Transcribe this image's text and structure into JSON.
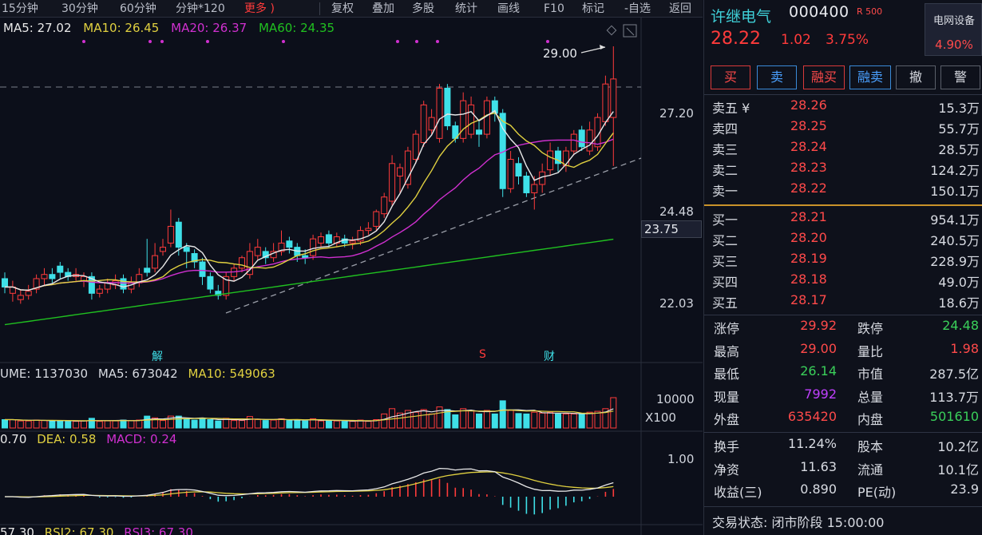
{
  "toolbar": {
    "items": [
      "15分钟",
      "30分钟",
      "60分钟",
      "分钟*120",
      "更多 )",
      "复权",
      "叠加",
      "多股",
      "统计",
      "画线",
      "F10",
      "标记",
      "-自选",
      "返回"
    ]
  },
  "ma_legend": {
    "ma5": "MA5: 27.02",
    "ma10": "MA10: 26.45",
    "ma20": "MA20: 26.37",
    "ma60": "MA60: 24.35"
  },
  "price_axis": {
    "labels": [
      "27.20",
      "24.48",
      "22.03"
    ],
    "current_box": "23.75",
    "high_marker": "29.00"
  },
  "event_markers": {
    "jie": "解",
    "s": "S",
    "cai": "财"
  },
  "volume_legend": {
    "vol": "UME: 1137030",
    "ma5": "MA5: 673042",
    "ma10": "MA10: 549063"
  },
  "volume_axis": {
    "label": "10000",
    "unit": "X100"
  },
  "macd_legend": {
    "dif": "0.70",
    "dea": "DEA: 0.58",
    "macd": "MACD: 0.24"
  },
  "macd_axis": {
    "label": "1.00"
  },
  "rsi_legend": {
    "rsi1": "57.30",
    "rsi2": "RSI2: 67.30",
    "rsi3": "RSI3: 67.30"
  },
  "stock": {
    "name": "许继电气",
    "code": "000400",
    "tag": "R 500",
    "price": "28.22",
    "change": "1.02",
    "change_pct": "3.75%",
    "sector_name": "电网设备",
    "sector_pct": "4.90%"
  },
  "trade_buttons": [
    "买",
    "卖",
    "融买",
    "融卖",
    "撤",
    "警"
  ],
  "order_book": {
    "asks": [
      {
        "label": "卖五 ¥",
        "price": "28.26",
        "volume": "15.3万"
      },
      {
        "label": "卖四",
        "price": "28.25",
        "volume": "55.7万"
      },
      {
        "label": "卖三",
        "price": "28.24",
        "volume": "28.5万"
      },
      {
        "label": "卖二",
        "price": "28.23",
        "volume": "124.2万"
      },
      {
        "label": "卖一",
        "price": "28.22",
        "volume": "150.1万"
      }
    ],
    "bids": [
      {
        "label": "买一",
        "price": "28.21",
        "volume": "954.1万"
      },
      {
        "label": "买二",
        "price": "28.20",
        "volume": "240.5万"
      },
      {
        "label": "买三",
        "price": "28.19",
        "volume": "228.9万"
      },
      {
        "label": "买四",
        "price": "28.18",
        "volume": "49.0万"
      },
      {
        "label": "买五",
        "price": "28.17",
        "volume": "18.6万"
      }
    ]
  },
  "stats": {
    "rows": [
      {
        "l1": "涨停",
        "v1": "29.92",
        "c1": "#ff4a4a",
        "l2": "跌停",
        "v2": "24.48",
        "c2": "#3ad05a"
      },
      {
        "l1": "最高",
        "v1": "29.00",
        "c1": "#ff4a4a",
        "l2": "量比",
        "v2": "1.98",
        "c2": "#ff4a4a"
      },
      {
        "l1": "最低",
        "v1": "26.14",
        "c1": "#3ad05a",
        "l2": "市值",
        "v2": "287.5亿",
        "c2": "#d8dbe2"
      },
      {
        "l1": "现量",
        "v1": "7992",
        "c1": "#c040ff",
        "l2": "总量",
        "v2": "113.7万",
        "c2": "#d8dbe2"
      },
      {
        "l1": "外盘",
        "v1": "635420",
        "c1": "#ff4a4a",
        "l2": "内盘",
        "v2": "501610",
        "c2": "#3ad05a"
      }
    ],
    "rows2": [
      {
        "l1": "换手",
        "v1": "11.24%",
        "l2": "股本",
        "v2": "10.2亿"
      },
      {
        "l1": "净资",
        "v1": "11.63",
        "l2": "流通",
        "v2": "10.1亿"
      },
      {
        "l1": "收益(三)",
        "v1": "0.890",
        "l2": "PE(动)",
        "v2": "23.9"
      }
    ]
  },
  "status": {
    "text": "交易状态: 闭市阶段 15:00:00"
  },
  "colors": {
    "up": "#ff3b3b",
    "down": "#3fe0e8",
    "ma5": "#e8e8e8",
    "ma10": "#e0d040",
    "ma20": "#d030d0",
    "ma60": "#20c020"
  },
  "chart_data": {
    "type": "candlestick",
    "ylim": [
      21.0,
      29.5
    ],
    "candles": [
      {
        "o": 23.45,
        "c": 23.25,
        "h": 23.6,
        "l": 23.1
      },
      {
        "o": 23.1,
        "c": 23.25,
        "h": 23.4,
        "l": 22.9
      },
      {
        "o": 22.95,
        "c": 23.05,
        "h": 23.2,
        "l": 22.85
      },
      {
        "o": 23.05,
        "c": 23.15,
        "h": 23.3,
        "l": 22.95
      },
      {
        "o": 23.2,
        "c": 23.45,
        "h": 23.55,
        "l": 23.1
      },
      {
        "o": 23.45,
        "c": 23.55,
        "h": 23.7,
        "l": 23.3
      },
      {
        "o": 23.55,
        "c": 23.45,
        "h": 23.7,
        "l": 23.35
      },
      {
        "o": 23.75,
        "c": 23.6,
        "h": 23.85,
        "l": 23.45
      },
      {
        "o": 23.6,
        "c": 23.5,
        "h": 23.7,
        "l": 23.4
      },
      {
        "o": 23.5,
        "c": 23.55,
        "h": 23.7,
        "l": 23.4
      },
      {
        "o": 23.4,
        "c": 23.5,
        "h": 23.6,
        "l": 23.25
      },
      {
        "o": 23.5,
        "c": 23.1,
        "h": 23.6,
        "l": 22.95
      },
      {
        "o": 23.1,
        "c": 23.2,
        "h": 23.3,
        "l": 23.0
      },
      {
        "o": 23.2,
        "c": 23.35,
        "h": 23.45,
        "l": 23.1
      },
      {
        "o": 23.3,
        "c": 23.4,
        "h": 23.55,
        "l": 23.2
      },
      {
        "o": 23.45,
        "c": 23.2,
        "h": 23.55,
        "l": 23.1
      },
      {
        "o": 23.2,
        "c": 23.35,
        "h": 23.5,
        "l": 23.1
      },
      {
        "o": 23.35,
        "c": 23.55,
        "h": 23.7,
        "l": 23.25
      },
      {
        "o": 23.7,
        "c": 23.6,
        "h": 24.4,
        "l": 23.5
      },
      {
        "o": 23.7,
        "c": 24.0,
        "h": 24.3,
        "l": 23.6
      },
      {
        "o": 24.1,
        "c": 24.2,
        "h": 24.4,
        "l": 24.0
      },
      {
        "o": 24.3,
        "c": 24.7,
        "h": 25.1,
        "l": 24.2
      },
      {
        "o": 24.8,
        "c": 24.2,
        "h": 24.9,
        "l": 24.0
      },
      {
        "o": 24.2,
        "c": 24.1,
        "h": 24.3,
        "l": 23.7
      },
      {
        "o": 24.05,
        "c": 23.85,
        "h": 24.15,
        "l": 23.7
      },
      {
        "o": 23.85,
        "c": 23.5,
        "h": 23.95,
        "l": 23.3
      },
      {
        "o": 23.5,
        "c": 23.2,
        "h": 23.6,
        "l": 23.1
      },
      {
        "o": 23.15,
        "c": 23.05,
        "h": 23.3,
        "l": 22.95
      },
      {
        "o": 23.05,
        "c": 23.5,
        "h": 23.6,
        "l": 22.95
      },
      {
        "o": 23.5,
        "c": 23.7,
        "h": 23.8,
        "l": 23.4
      },
      {
        "o": 23.7,
        "c": 23.95,
        "h": 24.0,
        "l": 23.6
      },
      {
        "o": 23.55,
        "c": 24.1,
        "h": 24.3,
        "l": 23.45
      },
      {
        "o": 24.0,
        "c": 24.2,
        "h": 24.4,
        "l": 23.9
      },
      {
        "o": 24.1,
        "c": 23.95,
        "h": 24.2,
        "l": 23.8
      },
      {
        "o": 23.95,
        "c": 24.1,
        "h": 24.3,
        "l": 23.85
      },
      {
        "o": 24.1,
        "c": 24.3,
        "h": 24.6,
        "l": 24.0
      },
      {
        "o": 24.35,
        "c": 24.2,
        "h": 24.45,
        "l": 24.05
      },
      {
        "o": 24.2,
        "c": 24.0,
        "h": 24.3,
        "l": 23.85
      },
      {
        "o": 24.0,
        "c": 23.95,
        "h": 24.15,
        "l": 23.8
      },
      {
        "o": 24.0,
        "c": 24.4,
        "h": 24.5,
        "l": 23.9
      },
      {
        "o": 24.3,
        "c": 24.45,
        "h": 24.55,
        "l": 24.2
      },
      {
        "o": 24.5,
        "c": 24.3,
        "h": 24.6,
        "l": 24.2
      },
      {
        "o": 24.3,
        "c": 24.45,
        "h": 24.55,
        "l": 24.2
      },
      {
        "o": 24.4,
        "c": 24.3,
        "h": 24.5,
        "l": 24.2
      },
      {
        "o": 24.3,
        "c": 24.35,
        "h": 24.45,
        "l": 24.15
      },
      {
        "o": 24.35,
        "c": 24.6,
        "h": 24.7,
        "l": 24.25
      },
      {
        "o": 24.6,
        "c": 24.65,
        "h": 24.8,
        "l": 24.5
      },
      {
        "o": 24.7,
        "c": 25.05,
        "h": 25.1,
        "l": 24.6
      },
      {
        "o": 25.0,
        "c": 25.4,
        "h": 25.5,
        "l": 24.9
      },
      {
        "o": 25.3,
        "c": 26.2,
        "h": 26.4,
        "l": 25.2
      },
      {
        "o": 25.9,
        "c": 26.1,
        "h": 26.2,
        "l": 25.5
      },
      {
        "o": 25.7,
        "c": 26.5,
        "h": 26.6,
        "l": 25.6
      },
      {
        "o": 26.3,
        "c": 26.9,
        "h": 27.0,
        "l": 26.2
      },
      {
        "o": 26.7,
        "c": 27.6,
        "h": 27.7,
        "l": 26.6
      },
      {
        "o": 27.0,
        "c": 27.3,
        "h": 27.5,
        "l": 26.9
      },
      {
        "o": 26.8,
        "c": 28.0,
        "h": 28.1,
        "l": 26.7
      },
      {
        "o": 28.0,
        "c": 27.1,
        "h": 28.1,
        "l": 27.0
      },
      {
        "o": 27.1,
        "c": 26.8,
        "h": 27.2,
        "l": 26.7
      },
      {
        "o": 26.8,
        "c": 27.7,
        "h": 27.9,
        "l": 26.7
      },
      {
        "o": 26.9,
        "c": 27.6,
        "h": 27.8,
        "l": 26.8
      },
      {
        "o": 27.0,
        "c": 26.9,
        "h": 27.2,
        "l": 26.6
      },
      {
        "o": 26.9,
        "c": 27.7,
        "h": 27.8,
        "l": 26.8
      },
      {
        "o": 27.7,
        "c": 27.4,
        "h": 27.8,
        "l": 27.2
      },
      {
        "o": 27.4,
        "c": 25.6,
        "h": 27.5,
        "l": 25.4
      },
      {
        "o": 25.6,
        "c": 26.3,
        "h": 26.5,
        "l": 25.5
      },
      {
        "o": 26.2,
        "c": 25.9,
        "h": 26.35,
        "l": 25.7
      },
      {
        "o": 25.9,
        "c": 25.5,
        "h": 26.0,
        "l": 25.4
      },
      {
        "o": 25.5,
        "c": 25.7,
        "h": 25.9,
        "l": 25.1
      },
      {
        "o": 25.7,
        "c": 26.0,
        "h": 26.2,
        "l": 25.5
      },
      {
        "o": 26.05,
        "c": 26.5,
        "h": 26.7,
        "l": 25.9
      },
      {
        "o": 26.5,
        "c": 26.2,
        "h": 26.6,
        "l": 26.0
      },
      {
        "o": 26.15,
        "c": 26.5,
        "h": 26.6,
        "l": 26.0
      },
      {
        "o": 26.5,
        "c": 26.9,
        "h": 27.0,
        "l": 26.4
      },
      {
        "o": 27.0,
        "c": 26.6,
        "h": 27.1,
        "l": 26.5
      },
      {
        "o": 26.5,
        "c": 27.0,
        "h": 27.2,
        "l": 26.4
      },
      {
        "o": 26.6,
        "c": 27.3,
        "h": 27.4,
        "l": 26.5
      },
      {
        "o": 27.2,
        "c": 28.1,
        "h": 28.3,
        "l": 27.1
      },
      {
        "o": 27.3,
        "c": 28.22,
        "h": 29.0,
        "l": 26.14
      }
    ]
  }
}
